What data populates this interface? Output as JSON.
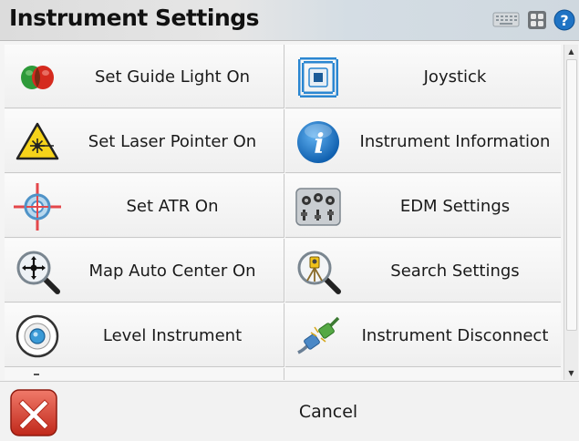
{
  "window": {
    "title": "Instrument Settings"
  },
  "toolbar_icons": [
    "keyboard-icon",
    "grid-icon",
    "help-icon"
  ],
  "tiles": [
    {
      "label": "Set Guide Light On",
      "icon": "guide-light-icon"
    },
    {
      "label": "Joystick",
      "icon": "joystick-icon"
    },
    {
      "label": "Set Laser Pointer On",
      "icon": "laser-warning-icon"
    },
    {
      "label": "Instrument Information",
      "icon": "info-icon"
    },
    {
      "label": "Set ATR On",
      "icon": "atr-target-icon"
    },
    {
      "label": "EDM Settings",
      "icon": "edm-settings-icon"
    },
    {
      "label": "Map Auto Center On",
      "icon": "map-center-magnifier-icon"
    },
    {
      "label": "Search Settings",
      "icon": "search-magnifier-icon"
    },
    {
      "label": "Level Instrument",
      "icon": "level-bubble-icon"
    },
    {
      "label": "Instrument Disconnect",
      "icon": "disconnect-plug-icon"
    }
  ],
  "footer": {
    "cancel_label": "Cancel"
  },
  "colors": {
    "guide_green": "#2e9a3a",
    "guide_red": "#d52a1e",
    "info_blue": "#1f73c4",
    "cancel_red": "#d33a2c"
  }
}
